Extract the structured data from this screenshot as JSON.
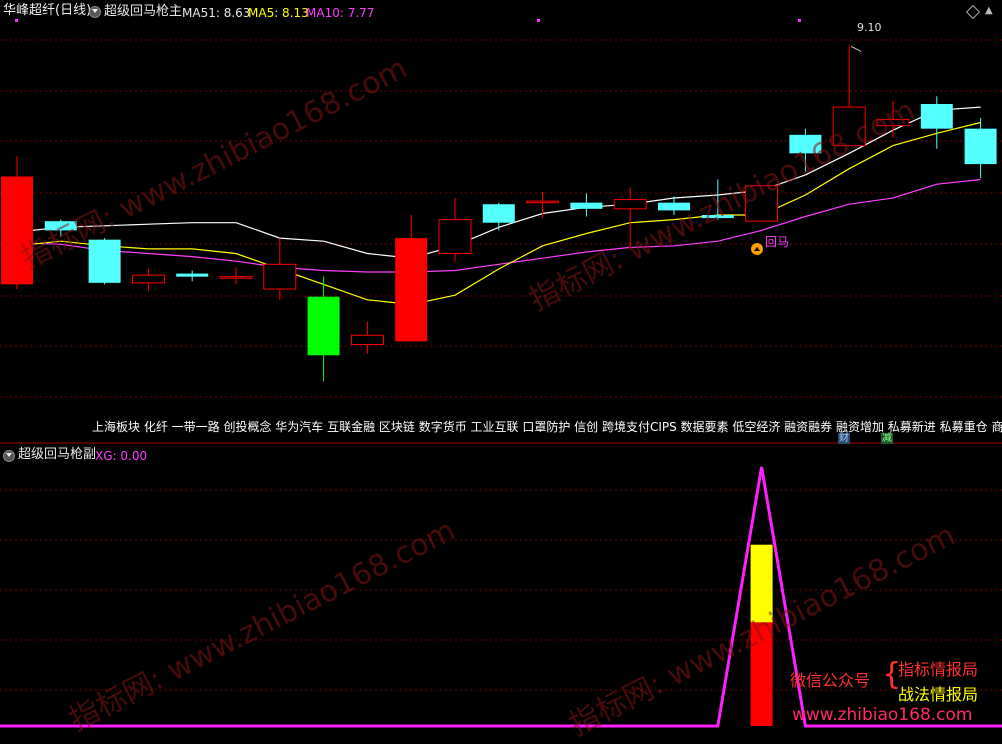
{
  "top_header": {
    "title": "华峰超纤(日线)",
    "indicator_name": "超级回马枪主",
    "ma51_label": "MA51: 8.63",
    "ma5_label": "MA5: 8.13",
    "ma10_label": "MA10: 7.77"
  },
  "sub_header": {
    "indicator_name": "超级回马枪副",
    "xg_label": "XG: 0.00"
  },
  "annotations": {
    "high_price": "9.10",
    "huima_signal": "回马"
  },
  "sector_tags": "上海板块 化纤 一带一路 创投概念 华为汽车 互联金融 区块链 数字货币 工业互联 口罩防护 信创 跨境支付CIPS 数据要素 低空经济  融资融券  融资增加 私募新进 私募重仓 商誉",
  "badges": {
    "cai": "财",
    "jian": "减"
  },
  "watermark": "指标网: www.zhibiao168.com",
  "promo": {
    "label": "微信公众号",
    "line1": "指标情报局",
    "line2": "战法情报局",
    "url": "www.zhibiao168.com"
  },
  "colors": {
    "up_candle": "#ff0000",
    "down_candle": "#54ffff",
    "doji_green": "#00ff00",
    "ma51": "#ffffff",
    "ma5": "#ffff00",
    "ma10": "#ff40ff",
    "grid": "#7a0000",
    "signal_line": "#ff20ff",
    "bar_yellow": "#ffff00",
    "bar_red": "#ff0000"
  },
  "chart_data": {
    "type": "candlestick",
    "candles": [
      {
        "o": 7.55,
        "c": 8.25,
        "h": 8.38,
        "l": 7.52,
        "style": "up-filled"
      },
      {
        "o": 7.96,
        "c": 7.9,
        "h": 7.97,
        "l": 7.86,
        "style": "down"
      },
      {
        "o": 7.84,
        "c": 7.56,
        "h": 7.85,
        "l": 7.55,
        "style": "down"
      },
      {
        "o": 7.56,
        "c": 7.61,
        "h": 7.65,
        "l": 7.51,
        "style": "up-hollow"
      },
      {
        "o": 7.62,
        "c": 7.6,
        "h": 7.64,
        "l": 7.57,
        "style": "down"
      },
      {
        "o": 7.59,
        "c": 7.6,
        "h": 7.66,
        "l": 7.55,
        "style": "up-hollow"
      },
      {
        "o": 7.52,
        "c": 7.68,
        "h": 7.85,
        "l": 7.45,
        "style": "up-hollow"
      },
      {
        "o": 7.47,
        "c": 7.09,
        "h": 7.6,
        "l": 6.92,
        "style": "doji-green"
      },
      {
        "o": 7.16,
        "c": 7.22,
        "h": 7.31,
        "l": 7.1,
        "style": "up-hollow"
      },
      {
        "o": 7.18,
        "c": 7.85,
        "h": 8.0,
        "l": 7.18,
        "style": "up-filled"
      },
      {
        "o": 7.75,
        "c": 7.97,
        "h": 8.11,
        "l": 7.7,
        "style": "up-hollow"
      },
      {
        "o": 8.07,
        "c": 7.95,
        "h": 8.08,
        "l": 7.9,
        "style": "down"
      },
      {
        "o": 8.08,
        "c": 8.09,
        "h": 8.15,
        "l": 7.98,
        "style": "up-hollow"
      },
      {
        "o": 8.08,
        "c": 8.04,
        "h": 8.14,
        "l": 7.99,
        "style": "down"
      },
      {
        "o": 8.04,
        "c": 8.1,
        "h": 8.18,
        "l": 7.78,
        "style": "up-hollow"
      },
      {
        "o": 8.08,
        "c": 8.03,
        "h": 8.12,
        "l": 8.0,
        "style": "down"
      },
      {
        "o": 7.98,
        "c": 8.0,
        "h": 8.23,
        "l": 7.97,
        "style": "down"
      },
      {
        "o": 7.96,
        "c": 8.19,
        "h": 8.19,
        "l": 7.96,
        "style": "up-hollow"
      },
      {
        "o": 8.52,
        "c": 8.4,
        "h": 8.56,
        "l": 8.28,
        "style": "down"
      },
      {
        "o": 8.45,
        "c": 8.7,
        "h": 9.1,
        "l": 8.45,
        "style": "up-hollow"
      },
      {
        "o": 8.58,
        "c": 8.62,
        "h": 8.74,
        "l": 8.5,
        "style": "up-hollow"
      },
      {
        "o": 8.72,
        "c": 8.56,
        "h": 8.77,
        "l": 8.43,
        "style": "down"
      },
      {
        "o": 8.56,
        "c": 8.33,
        "h": 8.63,
        "l": 8.24,
        "style": "down"
      }
    ],
    "ma51": [
      7.89,
      7.92,
      7.93,
      7.94,
      7.95,
      7.95,
      7.85,
      7.83,
      7.75,
      7.72,
      7.8,
      7.92,
      8.01,
      8.05,
      8.07,
      8.11,
      8.13,
      8.16,
      8.26,
      8.4,
      8.55,
      8.68,
      8.7
    ],
    "ma5": [
      7.8,
      7.83,
      7.8,
      7.78,
      7.78,
      7.75,
      7.65,
      7.55,
      7.45,
      7.42,
      7.48,
      7.65,
      7.8,
      7.88,
      7.95,
      7.97,
      8.0,
      8.0,
      8.13,
      8.3,
      8.45,
      8.53,
      8.6
    ],
    "ma10": [
      7.82,
      7.81,
      7.77,
      7.75,
      7.73,
      7.7,
      7.66,
      7.64,
      7.63,
      7.63,
      7.64,
      7.68,
      7.72,
      7.76,
      7.79,
      7.8,
      7.83,
      7.9,
      7.99,
      8.07,
      8.11,
      8.2,
      8.23
    ],
    "signal": [
      0,
      0,
      0,
      0,
      0,
      0,
      0,
      0,
      0,
      0,
      0,
      0,
      0,
      0,
      0,
      0,
      0,
      1,
      0,
      0,
      0,
      0,
      0
    ]
  }
}
